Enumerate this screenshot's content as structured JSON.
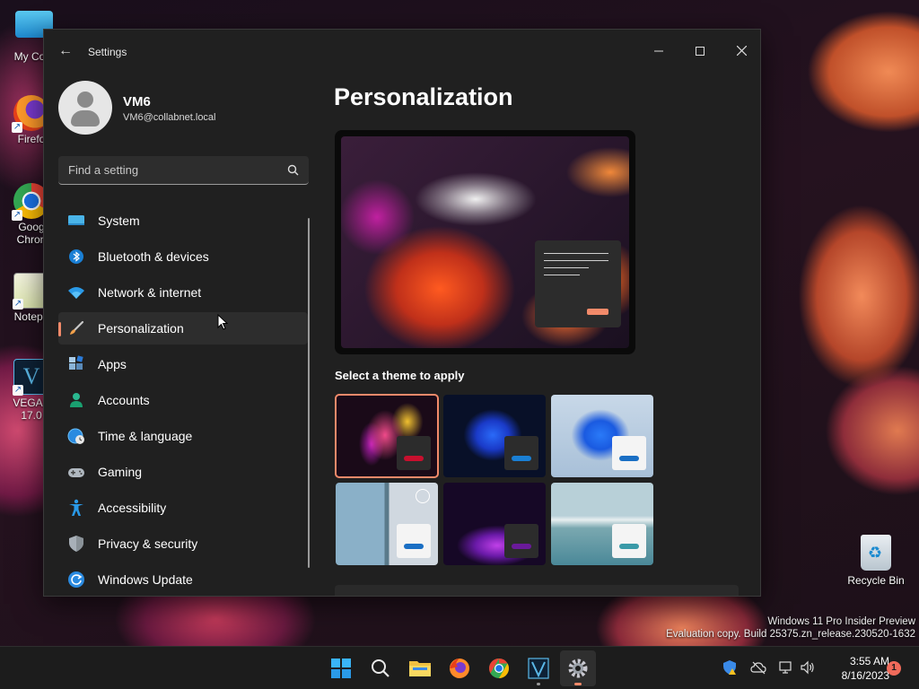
{
  "desktop": {
    "icons": [
      {
        "label": "My Com",
        "icon": "computer-icon"
      },
      {
        "label": "Firefo",
        "icon": "firefox-icon"
      },
      {
        "label": "Goog",
        "label2": "Chron",
        "icon": "chrome-icon"
      },
      {
        "label": "Notepa",
        "icon": "notepad-icon"
      },
      {
        "label": "VEGAS",
        "label2": "17.0",
        "icon": "vegas-icon"
      }
    ],
    "recycle_bin": "Recycle Bin",
    "watermark_line1": "Windows 11 Pro Insider Preview",
    "watermark_line2": "Evaluation copy. Build 25375.zn_release.230520-1632"
  },
  "window": {
    "title": "Settings",
    "profile": {
      "name": "VM6",
      "email": "VM6@collabnet.local"
    },
    "search": {
      "placeholder": "Find a setting"
    },
    "nav": [
      {
        "label": "System",
        "icon": "system-icon"
      },
      {
        "label": "Bluetooth & devices",
        "icon": "bluetooth-icon"
      },
      {
        "label": "Network & internet",
        "icon": "wifi-icon"
      },
      {
        "label": "Personalization",
        "icon": "brush-icon",
        "active": true
      },
      {
        "label": "Apps",
        "icon": "apps-icon"
      },
      {
        "label": "Accounts",
        "icon": "accounts-icon"
      },
      {
        "label": "Time & language",
        "icon": "globe-clock-icon"
      },
      {
        "label": "Gaming",
        "icon": "gamepad-icon"
      },
      {
        "label": "Accessibility",
        "icon": "accessibility-icon"
      },
      {
        "label": "Privacy & security",
        "icon": "shield-icon"
      },
      {
        "label": "Windows Update",
        "icon": "update-icon"
      }
    ],
    "main": {
      "title": "Personalization",
      "theme_heading": "Select a theme to apply",
      "themes": [
        {
          "name": "glow-dark",
          "selected": true,
          "accent": "#c8102e"
        },
        {
          "name": "bloom-dark",
          "accent": "#1a7fd4"
        },
        {
          "name": "bloom-light",
          "accent": "#1a6fc4"
        },
        {
          "name": "spotlight",
          "accent": "#1a6fc4"
        },
        {
          "name": "sunrise",
          "accent": "#6a1a9a"
        },
        {
          "name": "flow",
          "accent": "#3a9aa8"
        }
      ]
    }
  },
  "taskbar": {
    "apps": [
      "start-icon",
      "search-icon",
      "file-explorer-icon",
      "firefox-icon",
      "chrome-icon",
      "vegas-icon",
      "settings-icon"
    ],
    "time": "3:55 AM",
    "date": "8/16/2023",
    "notification_count": "1"
  },
  "colors": {
    "accent": "#f28a6a",
    "window_bg": "#202020",
    "taskbar_bg": "#1c1c1c"
  }
}
